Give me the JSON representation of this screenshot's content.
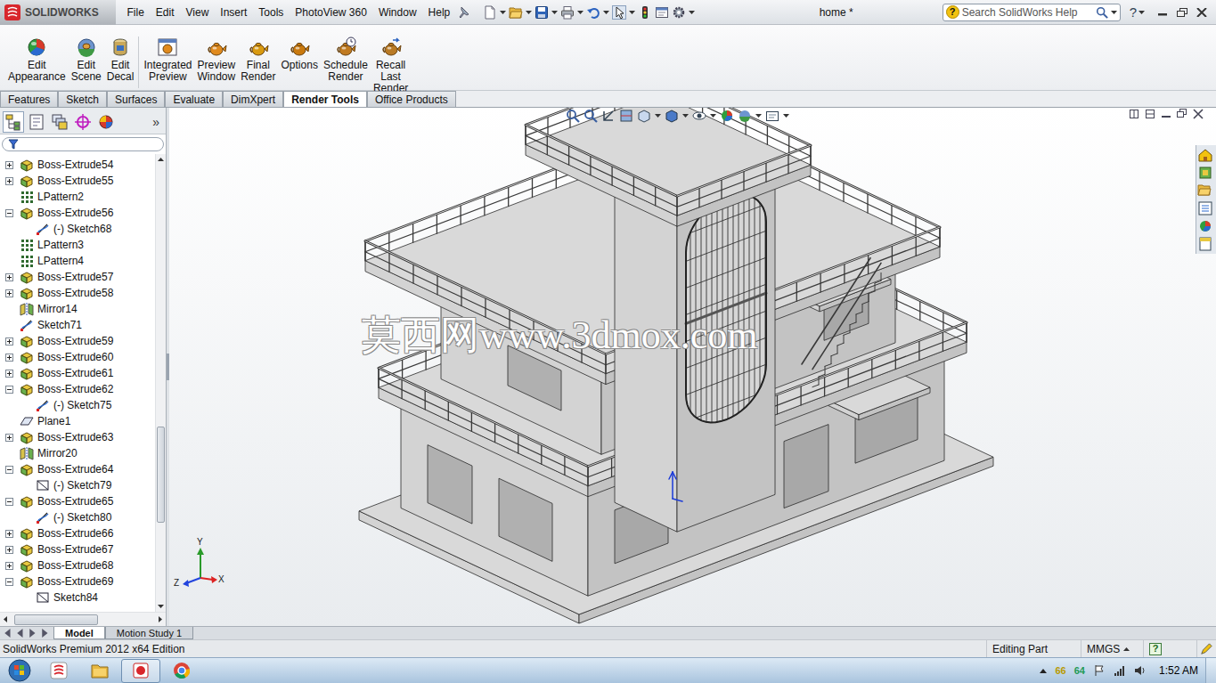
{
  "app": {
    "logo": "SOLIDWORKS",
    "title": "home *",
    "help": "?"
  },
  "menu": [
    "File",
    "Edit",
    "View",
    "Insert",
    "Tools",
    "PhotoView 360",
    "Window",
    "Help"
  ],
  "search": {
    "icon": "?",
    "placeholder": "Search SolidWorks Help"
  },
  "command_buttons": [
    {
      "label": "Edit Appearance"
    },
    {
      "label": "Edit Scene"
    },
    {
      "label": "Edit Decal"
    },
    {
      "label": "Integrated Preview"
    },
    {
      "label": "Preview Window"
    },
    {
      "label": "Final Render"
    },
    {
      "label": "Options"
    },
    {
      "label": "Schedule Render"
    },
    {
      "label": "Recall Last Render"
    }
  ],
  "ribbon_tabs": [
    {
      "label": "Features",
      "selected": false
    },
    {
      "label": "Sketch",
      "selected": false
    },
    {
      "label": "Surfaces",
      "selected": false
    },
    {
      "label": "Evaluate",
      "selected": false
    },
    {
      "label": "DimXpert",
      "selected": false
    },
    {
      "label": "Render Tools",
      "selected": true
    },
    {
      "label": "Office Products",
      "selected": false
    }
  ],
  "feature_manager": {
    "panel_tabs": [
      {
        "selected": true
      },
      {
        "selected": false
      },
      {
        "selected": false
      },
      {
        "selected": false
      },
      {
        "selected": false
      }
    ],
    "more": "»",
    "items": [
      {
        "label": "Boss-Extrude54",
        "kind": "extrude",
        "depth": 0,
        "expandable": true,
        "expanded": false
      },
      {
        "label": "Boss-Extrude55",
        "kind": "extrude",
        "depth": 0,
        "expandable": true,
        "expanded": false
      },
      {
        "label": "LPattern2",
        "kind": "pattern",
        "depth": 0,
        "expandable": false,
        "expanded": false
      },
      {
        "label": "Boss-Extrude56",
        "kind": "extrude",
        "depth": 0,
        "expandable": true,
        "expanded": true
      },
      {
        "label": "(-) Sketch68",
        "kind": "sketch",
        "depth": 1,
        "expandable": false,
        "expanded": false
      },
      {
        "label": "LPattern3",
        "kind": "pattern",
        "depth": 0,
        "expandable": false,
        "expanded": false
      },
      {
        "label": "LPattern4",
        "kind": "pattern",
        "depth": 0,
        "expandable": false,
        "expanded": false
      },
      {
        "label": "Boss-Extrude57",
        "kind": "extrude",
        "depth": 0,
        "expandable": true,
        "expanded": false
      },
      {
        "label": "Boss-Extrude58",
        "kind": "extrude",
        "depth": 0,
        "expandable": true,
        "expanded": false
      },
      {
        "label": "Mirror14",
        "kind": "mirror",
        "depth": 0,
        "expandable": false,
        "expanded": false
      },
      {
        "label": "Sketch71",
        "kind": "sketch",
        "depth": 0,
        "expandable": false,
        "expanded": false
      },
      {
        "label": "Boss-Extrude59",
        "kind": "extrude",
        "depth": 0,
        "expandable": true,
        "expanded": false
      },
      {
        "label": "Boss-Extrude60",
        "kind": "extrude",
        "depth": 0,
        "expandable": true,
        "expanded": false
      },
      {
        "label": "Boss-Extrude61",
        "kind": "extrude",
        "depth": 0,
        "expandable": true,
        "expanded": false
      },
      {
        "label": "Boss-Extrude62",
        "kind": "extrude",
        "depth": 0,
        "expandable": true,
        "expanded": true
      },
      {
        "label": "(-) Sketch75",
        "kind": "sketch",
        "depth": 1,
        "expandable": false,
        "expanded": false
      },
      {
        "label": "Plane1",
        "kind": "plane",
        "depth": 0,
        "expandable": false,
        "expanded": false
      },
      {
        "label": "Boss-Extrude63",
        "kind": "extrude",
        "depth": 0,
        "expandable": true,
        "expanded": false
      },
      {
        "label": "Mirror20",
        "kind": "mirror",
        "depth": 0,
        "expandable": false,
        "expanded": false
      },
      {
        "label": "Boss-Extrude64",
        "kind": "extrude",
        "depth": 0,
        "expandable": true,
        "expanded": true
      },
      {
        "label": "(-) Sketch79",
        "kind": "sketchbox",
        "depth": 1,
        "expandable": false,
        "expanded": false
      },
      {
        "label": "Boss-Extrude65",
        "kind": "extrude",
        "depth": 0,
        "expandable": true,
        "expanded": true
      },
      {
        "label": "(-) Sketch80",
        "kind": "sketch",
        "depth": 1,
        "expandable": false,
        "expanded": false
      },
      {
        "label": "Boss-Extrude66",
        "kind": "extrude",
        "depth": 0,
        "expandable": true,
        "expanded": false
      },
      {
        "label": "Boss-Extrude67",
        "kind": "extrude",
        "depth": 0,
        "expandable": true,
        "expanded": false
      },
      {
        "label": "Boss-Extrude68",
        "kind": "extrude",
        "depth": 0,
        "expandable": true,
        "expanded": false
      },
      {
        "label": "Boss-Extrude69",
        "kind": "extrude",
        "depth": 0,
        "expandable": true,
        "expanded": true
      },
      {
        "label": "Sketch84",
        "kind": "sketchbox",
        "depth": 1,
        "expandable": false,
        "expanded": false
      }
    ],
    "scrollbar": {
      "position": 0.77
    },
    "hscrollbar": {
      "position": 0.06
    }
  },
  "viewport": {
    "watermark": "莫西网www.3dmox.com",
    "triad": {
      "y": "Y",
      "z": "Z",
      "x": "X"
    }
  },
  "bottom_tabs": [
    {
      "label": "Model",
      "selected": true
    },
    {
      "label": "Motion Study 1",
      "selected": false
    }
  ],
  "status_bar": {
    "edition": "SolidWorks Premium 2012 x64 Edition",
    "mode": "Editing Part",
    "units": "MMGS",
    "help": "?"
  },
  "taskbar": {
    "tray": [
      {
        "text": "66",
        "color": "#b89a00"
      },
      {
        "text": "64",
        "color": "#1f9a55"
      }
    ],
    "time": "1:52 AM"
  }
}
